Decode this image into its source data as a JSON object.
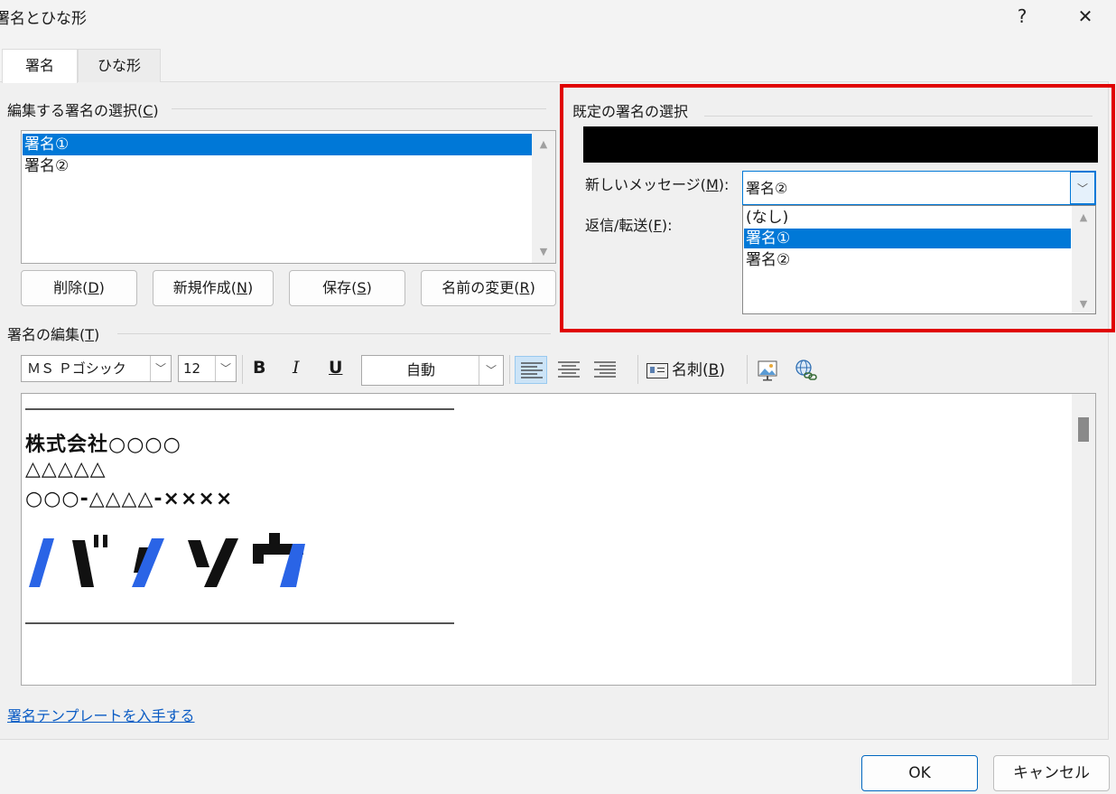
{
  "window": {
    "title": "署名とひな形",
    "help": "?",
    "close": "✕"
  },
  "tabs": [
    {
      "label": "署名"
    },
    {
      "label": "ひな形"
    }
  ],
  "select_group": {
    "label_prefix": "編集する署名の選択(",
    "label_key": "C",
    "label_suffix": ")",
    "items": [
      "署名①",
      "署名②"
    ],
    "selected_index": 0
  },
  "buttons": {
    "delete": {
      "prefix": "削除(",
      "key": "D",
      "suffix": ")"
    },
    "new": {
      "prefix": "新規作成(",
      "key": "N",
      "suffix": ")"
    },
    "save": {
      "prefix": "保存(",
      "key": "S",
      "suffix": ")"
    },
    "rename": {
      "prefix": "名前の変更(",
      "key": "R",
      "suffix": ")"
    }
  },
  "default_group": {
    "label": "既定の署名の選択",
    "new_message": {
      "prefix": "新しいメッセージ(",
      "key": "M",
      "suffix": "):",
      "value": "署名②"
    },
    "reply": {
      "prefix": "返信/転送(",
      "key": "F",
      "suffix": "):"
    },
    "dropdown_options": [
      "(なし)",
      "署名①",
      "署名②"
    ],
    "dropdown_highlighted_index": 1
  },
  "edit_group": {
    "label_prefix": "署名の編集(",
    "label_key": "T",
    "label_suffix": ")"
  },
  "toolbar": {
    "font": "ＭＳ Ｐゴシック",
    "size": "12",
    "bold": "B",
    "italic": "I",
    "underline": "U",
    "color": "自動",
    "business_card_prefix": "名刺(",
    "business_card_key": "B",
    "business_card_suffix": ")",
    "icons": [
      "bold-icon",
      "italic-icon",
      "underline-icon",
      "align-left-icon",
      "align-center-icon",
      "align-right-icon",
      "business-card-icon",
      "insert-picture-icon",
      "hyperlink-icon"
    ]
  },
  "signature": {
    "company": "株式会社○○○○",
    "line2": "△△△△△",
    "phone": "○○○-△△△△-××××",
    "logo_text": "バンソウ",
    "logo_colors": {
      "blue": "#2a64e6",
      "black": "#111111"
    }
  },
  "template_link": "署名テンプレートを入手する",
  "footer": {
    "ok": "OK",
    "cancel": "キャンセル"
  },
  "colors": {
    "accent": "#0078d7",
    "highlight": "#e00000"
  }
}
